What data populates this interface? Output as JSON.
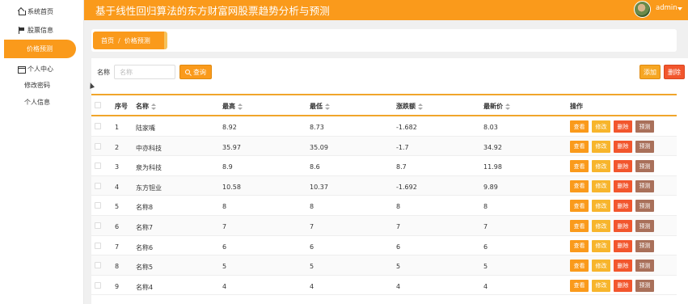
{
  "header": {
    "title": "基于线性回归算法的东方财富网股票趋势分析与预测",
    "user": "admin"
  },
  "sidebar": {
    "items": [
      {
        "label": "系统首页",
        "icon": "home-icon"
      },
      {
        "label": "股票信息",
        "icon": "flag-icon"
      },
      {
        "label": "价格预测",
        "icon": "grid-icon",
        "active": true
      },
      {
        "label": "个人中心",
        "icon": "box-icon"
      }
    ],
    "sub_items": [
      {
        "label": "修改密码"
      },
      {
        "label": "个人信息"
      }
    ]
  },
  "breadcrumb": {
    "home": "首页",
    "separator": "/",
    "current": "价格预测"
  },
  "search": {
    "label": "名称",
    "placeholder": "名称",
    "query_label": "查询"
  },
  "toolbar": {
    "add_label": "添加",
    "delete_label": "删除"
  },
  "table": {
    "columns": [
      "序号",
      "名称",
      "最高",
      "最低",
      "涨跌额",
      "最新价",
      "操作"
    ],
    "action_labels": {
      "view": "查看",
      "edit": "修改",
      "delete": "删除",
      "predict": "预测"
    },
    "rows": [
      {
        "no": "1",
        "name": "陆家嘴",
        "high": "8.92",
        "low": "8.73",
        "change": "-1.682",
        "latest": "8.03"
      },
      {
        "no": "2",
        "name": "中亦科技",
        "high": "35.97",
        "low": "35.09",
        "change": "-1.7",
        "latest": "34.92"
      },
      {
        "no": "3",
        "name": "泉为科技",
        "high": "8.9",
        "low": "8.6",
        "change": "8.7",
        "latest": "11.98"
      },
      {
        "no": "4",
        "name": "东方钽业",
        "high": "10.58",
        "low": "10.37",
        "change": "-1.692",
        "latest": "9.89"
      },
      {
        "no": "5",
        "name": "名称8",
        "high": "8",
        "low": "8",
        "change": "8",
        "latest": "8"
      },
      {
        "no": "6",
        "name": "名称7",
        "high": "7",
        "low": "7",
        "change": "7",
        "latest": "7"
      },
      {
        "no": "7",
        "name": "名称6",
        "high": "6",
        "low": "6",
        "change": "6",
        "latest": "6"
      },
      {
        "no": "8",
        "name": "名称5",
        "high": "5",
        "low": "5",
        "change": "5",
        "latest": "5"
      },
      {
        "no": "9",
        "name": "名称4",
        "high": "4",
        "low": "4",
        "change": "4",
        "latest": "4"
      }
    ]
  },
  "colors": {
    "accent": "#fa9a1b",
    "view": "#fa9a1b",
    "edit": "#f7b52c",
    "delete": "#f2562d",
    "predict": "#a9705a"
  }
}
